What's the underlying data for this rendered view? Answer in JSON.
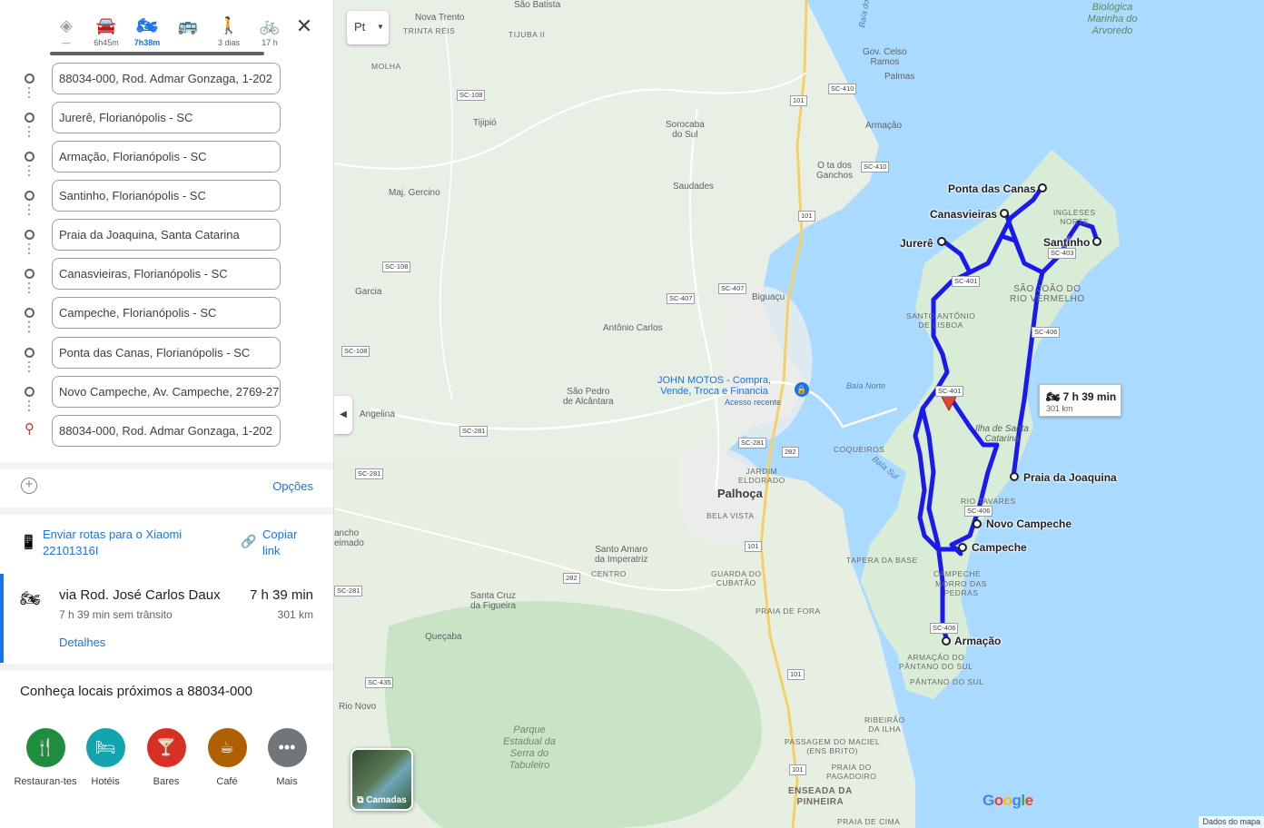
{
  "modes": [
    {
      "icon": "best-route-icon",
      "glyph": "◈",
      "label": "—"
    },
    {
      "icon": "car-icon",
      "glyph": "🚘",
      "label": "6h45m"
    },
    {
      "icon": "motorcycle-icon",
      "glyph": "🏍",
      "label": "7h38m"
    },
    {
      "icon": "transit-icon",
      "glyph": "🚌",
      "label": ""
    },
    {
      "icon": "walk-icon",
      "glyph": "🚶",
      "label": "3 dias"
    },
    {
      "icon": "bicycle-icon",
      "glyph": "🚲",
      "label": "17 h"
    }
  ],
  "stops": [
    "88034-000, Rod. Admar Gonzaga, 1-202",
    "Jurerê, Florianópolis - SC",
    "Armação, Florianópolis - SC",
    "Santinho, Florianópolis - SC",
    "Praia da Joaquina, Santa Catarina",
    "Canasvieiras, Florianópolis - SC",
    "Campeche, Florianópolis - SC",
    "Ponta das Canas, Florianópolis - SC",
    "Novo Campeche, Av. Campeche, 2769-27",
    "88034-000, Rod. Admar Gonzaga, 1-202"
  ],
  "options_label": "Opções",
  "send": {
    "label": "Enviar rotas para o Xiaomi 22101316I",
    "copy_label": "Copiar link"
  },
  "route": {
    "via": "via Rod. José Carlos Daux",
    "time": "7 h 39 min",
    "traffic": "7 h 39 min sem trânsito",
    "distance": "301 km",
    "details": "Detalhes"
  },
  "nearby": {
    "title": "Conheça locais próximos a 88034-000",
    "items": [
      {
        "label": "Restauran-tes",
        "icon": "restaurant-icon",
        "glyph": "🍴",
        "color": "#1e8e3e"
      },
      {
        "label": "Hotéis",
        "icon": "hotel-icon",
        "glyph": "🛏",
        "color": "#12a4af"
      },
      {
        "label": "Bares",
        "icon": "bar-icon",
        "glyph": "🍸",
        "color": "#d93025"
      },
      {
        "label": "Café",
        "icon": "coffee-icon",
        "glyph": "☕",
        "color": "#b06000"
      },
      {
        "label": "Mais",
        "icon": "more-icon",
        "glyph": "•••",
        "color": "#70757a"
      }
    ]
  },
  "map": {
    "lang_button": "Pt",
    "layers_label": "Camadas",
    "map_data": "Dados do mapa",
    "tooltip_time": "7 h 39 min",
    "tooltip_dist": "301 km",
    "waypoint_labels": [
      "Ponta das Canas",
      "Canasvieiras",
      "Jurerê",
      "Santinho",
      "Praia da Joaquina",
      "Novo Campeche",
      "Campeche",
      "Armação"
    ],
    "place_labels": [
      "Nova Trento",
      "TRINTA RÉIS",
      "São Batista",
      "TIJUBA II",
      "MOLHA",
      "Tijipió",
      "Sorocaba do Sul",
      "Saudades",
      "Maj. Gercino",
      "Garcia",
      "Antônio Carlos",
      "São Pedro de Alcântara",
      "Angelina",
      "Biguaçu",
      "Palhoça",
      "JARDIM ELDORADO",
      "BELA VISTA",
      "Santo Amaro da Imperatriz",
      "CENTRO",
      "GUARDA DO CUBATÃO",
      "Santa Cruz da Figueira",
      "Queçaba",
      "Rio Novo",
      "PRAIA DE FORA",
      "TAPERA DA BASE",
      "CAMPECHE",
      "MORRO DAS PEDRAS",
      "ARMAÇÃO DO PÂNTANO DO SUL",
      "PÂNTANO DO SUL",
      "RIBEIRÃO DA ILHA",
      "PASSAGEM DO MACIEL (ENS BRITO)",
      "PRAIA DO PAGADOIRO",
      "ENSEADA DA PINHEIRA",
      "Governador Celso Ramos",
      "Palmas",
      "Armação",
      "O ta dos Ganchos",
      "INGLESES",
      "SÃO JOÃO DO RIO VERMELHO",
      "SANTO ANTÔNIO DE LISBOA",
      "Ilha de Santa Catarina",
      "COQUEIROS",
      "RIO TAVARES",
      "Reserva Biológica Marinha do Arvoredo",
      "Parque Estadual da Serra do Tabuleiro",
      "Baía Norte",
      "Baía Sul",
      "Baía do",
      "JOHN MOTOS - Compra, Vende, Troca e Financia",
      "Acesso recente",
      "PRAIA DE CIMA",
      "ancho eimado"
    ],
    "road_shields": [
      "SC-108",
      "SC-410",
      "SC-410",
      "101",
      "101",
      "SC-108",
      "SC-407",
      "SC-407",
      "SC-108",
      "SC-281",
      "SC-281",
      "SC-281",
      "282",
      "101",
      "282",
      "101",
      "SC-435",
      "SC-281",
      "SC-401",
      "SC-403",
      "SC-406",
      "SC-401",
      "SC-406",
      "SC-406",
      "101"
    ],
    "logo": "Google"
  }
}
